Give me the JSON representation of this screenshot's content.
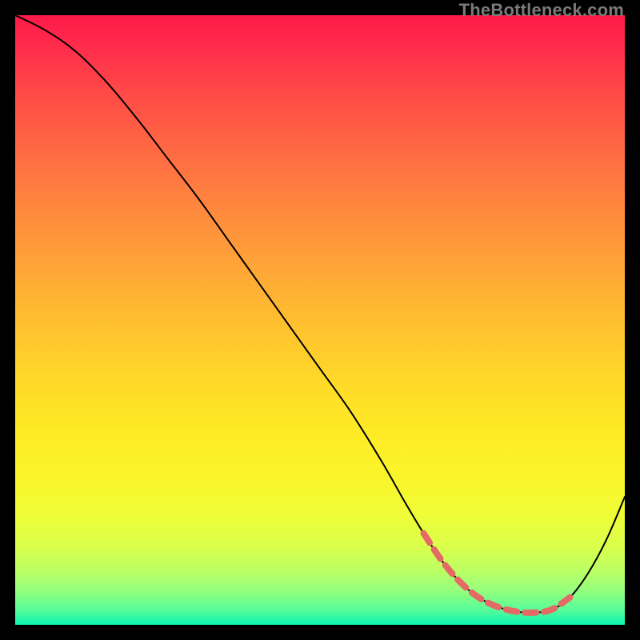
{
  "watermark": "TheBottleneck.com",
  "chart_data": {
    "type": "line",
    "title": "",
    "xlabel": "",
    "ylabel": "",
    "xlim": [
      0,
      100
    ],
    "ylim": [
      0,
      100
    ],
    "grid": false,
    "legend": false,
    "series": [
      {
        "name": "bottleneck-curve",
        "x": [
          0,
          5,
          10,
          15,
          20,
          25,
          30,
          35,
          40,
          45,
          50,
          55,
          60,
          64,
          67,
          70,
          73,
          76,
          79,
          82,
          85,
          88,
          91,
          94,
          97,
          100
        ],
        "y": [
          100,
          97.5,
          94,
          89,
          83,
          76.5,
          70,
          63,
          56,
          49,
          42,
          35,
          27,
          20,
          15,
          10.5,
          7,
          4.5,
          3,
          2.2,
          2,
          2.5,
          4.5,
          8.5,
          14,
          21
        ]
      }
    ],
    "highlight": {
      "name": "optimal-range",
      "x_range": [
        67,
        92
      ],
      "description": "lowest-bottleneck region along curve"
    },
    "background_gradient": {
      "stops": [
        {
          "pos": 0,
          "color": "#ff1a4a"
        },
        {
          "pos": 0.5,
          "color": "#ffc42e"
        },
        {
          "pos": 0.82,
          "color": "#effd37"
        },
        {
          "pos": 1,
          "color": "#0cf4b1"
        }
      ]
    }
  }
}
